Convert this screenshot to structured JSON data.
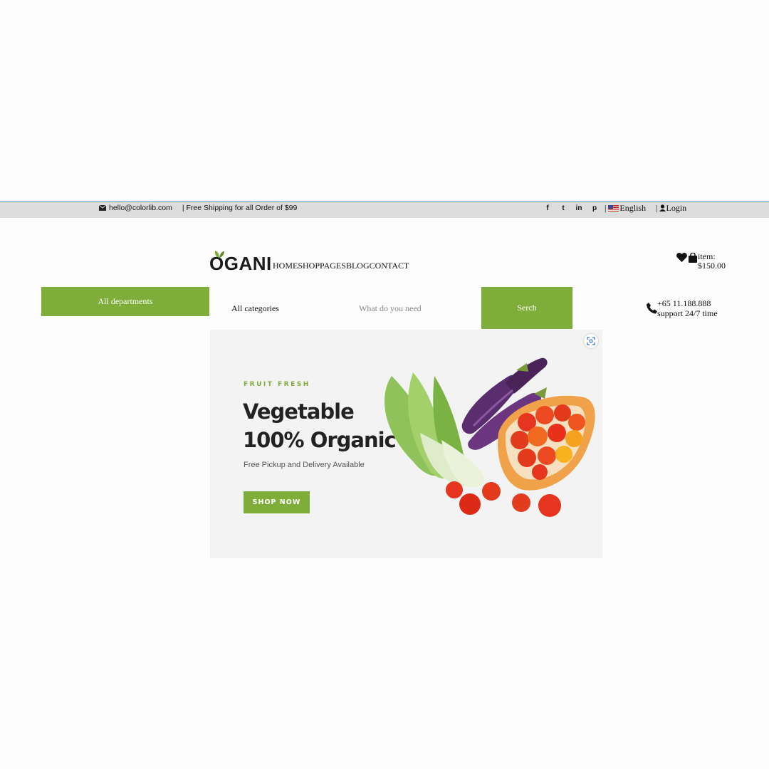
{
  "topbar": {
    "email": "hello@colorlib.com",
    "shipping": "| Free Shipping for all Order of $99",
    "social": [
      "f",
      "t",
      "in",
      "p"
    ],
    "language": "English",
    "login": "Login"
  },
  "header": {
    "logo": "OGANI",
    "nav": [
      "HOME",
      "SHOP",
      "PAGES",
      "BLOG",
      "CONTACT"
    ],
    "cart_label": "item:",
    "cart_total": "$150.00"
  },
  "search": {
    "departments": "All departments",
    "categories": "All categories",
    "placeholder": "What do you need",
    "button": "Serch"
  },
  "contact": {
    "phone": "+65 11.188.888",
    "support": "support 24/7 time"
  },
  "hero": {
    "tag": "FRUIT FRESH",
    "title_line1": "Vegetable",
    "title_line2": "100% Organic",
    "subtitle": "Free Pickup and Delivery Available",
    "button": "SHOP NOW"
  },
  "colors": {
    "accent": "#7fad39",
    "topbar_bg": "#dcdcdc",
    "hero_bg": "#f3f3f3"
  },
  "icons": [
    "envelope-icon",
    "flag-icon",
    "user-icon",
    "heart-icon",
    "bag-icon",
    "phone-icon",
    "visual-search-icon"
  ]
}
